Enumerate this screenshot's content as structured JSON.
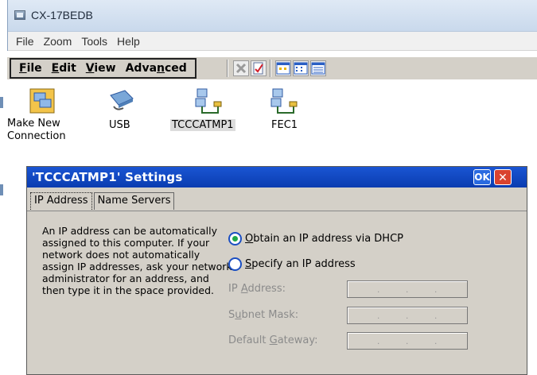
{
  "host": {
    "title": "CX-17BEDB",
    "menu": [
      "File",
      "Zoom",
      "Tools",
      "Help"
    ]
  },
  "device": {
    "menu": [
      {
        "label": "File",
        "underline": "F",
        "rest": "ile"
      },
      {
        "label": "Edit",
        "underline": "E",
        "rest": "dit"
      },
      {
        "label": "View",
        "underline": "V",
        "rest": "iew"
      },
      {
        "label": "Advanced",
        "pre": "Adva",
        "underline": "n",
        "rest": "ced"
      }
    ],
    "icons": {
      "make_new": "Make New\nConnection",
      "make_new_line1": "Make New",
      "make_new_line2": "Connection",
      "usb": "USB",
      "tcc": "TCCCATMP1",
      "fec": "FEC1"
    }
  },
  "dialog": {
    "title": "'TCCCATMP1' Settings",
    "ok": "OK",
    "close": "✕",
    "tabs": [
      "IP Address",
      "Name Servers"
    ],
    "help_text": "An IP address can be automatically assigned to this computer.  If your network does not automatically assign IP addresses, ask your network administrator for an address, and then type it in the space provided.",
    "radio_dhcp": {
      "pre": "",
      "u": "O",
      "rest": "btain an IP address via DHCP",
      "checked": true
    },
    "radio_specify": {
      "pre": "",
      "u": "S",
      "rest": "pecify an IP address",
      "checked": false
    },
    "fields": [
      {
        "pre": "IP ",
        "u": "A",
        "rest": "ddress:"
      },
      {
        "pre": "S",
        "u": "u",
        "rest": "bnet Mask:"
      },
      {
        "pre": "Default ",
        "u": "G",
        "rest": "ateway:"
      }
    ]
  },
  "colors": {
    "dialog_title": "#0a3cb0",
    "radio_checked": "#1ea84a",
    "host_frame": "#d9e4f1"
  }
}
